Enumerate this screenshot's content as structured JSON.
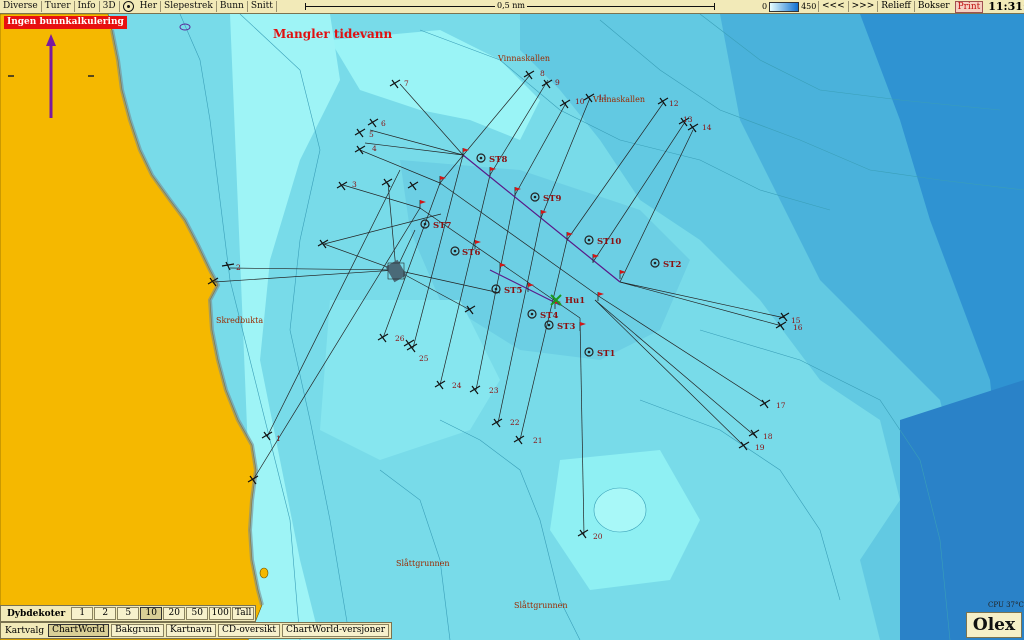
{
  "toolbar": {
    "menu": [
      "Diverse",
      "Turer",
      "Info",
      "3D"
    ],
    "her_label": "Her",
    "tools": [
      "Slepestrek",
      "Bunn",
      "Snitt"
    ],
    "scale_label": "0,5 nm",
    "depth_min": "0",
    "depth_max": "450",
    "nav_back": "<<<",
    "nav_fwd": ">>>",
    "relief": "Relieff",
    "bokser": "Bokser",
    "print": "Print",
    "clock": "11:31:06"
  },
  "map": {
    "alert": "Ingen bunnkalkulering",
    "tide_warning": "Mangler tidevann",
    "places": [
      {
        "name": "Vinnaskallen"
      },
      {
        "name": "Vinnaskallen"
      },
      {
        "name": "Skredbukta"
      },
      {
        "name": "Slåttgrunnen"
      },
      {
        "name": "Slåttgrunnen"
      }
    ],
    "stations": [
      "ST8",
      "ST9",
      "ST7",
      "ST10",
      "ST6",
      "ST2",
      "ST5",
      "ST4",
      "ST3",
      "ST1"
    ],
    "marker_label": "Hu1",
    "anchors": [
      "1",
      "2",
      "3",
      "4",
      "5",
      "6",
      "7",
      "8",
      "9",
      "10",
      "11",
      "12",
      "13",
      "14",
      "15",
      "16",
      "17",
      "18",
      "19",
      "20",
      "21",
      "22",
      "23",
      "24",
      "25",
      "26"
    ],
    "cpu": "CPU 37°C",
    "logo": "Olex"
  },
  "depth_contours": {
    "title": "Dybdekoter",
    "options": [
      "1",
      "2",
      "5",
      "10",
      "20",
      "50",
      "100",
      "Tall"
    ],
    "selected": "10"
  },
  "chart_select": {
    "title": "Kartvalg",
    "options": [
      "ChartWorld",
      "Bakgrunn",
      "Kartnavn",
      "CD-oversikt",
      "ChartWorld-versjoner"
    ],
    "selected": "ChartWorld"
  },
  "colors": {
    "land": "#f5b800",
    "shallow_water": "#8ef2f2",
    "deep_water": "#2a90d6",
    "alert_red": "#e81010",
    "label_red": "#8a1010"
  }
}
